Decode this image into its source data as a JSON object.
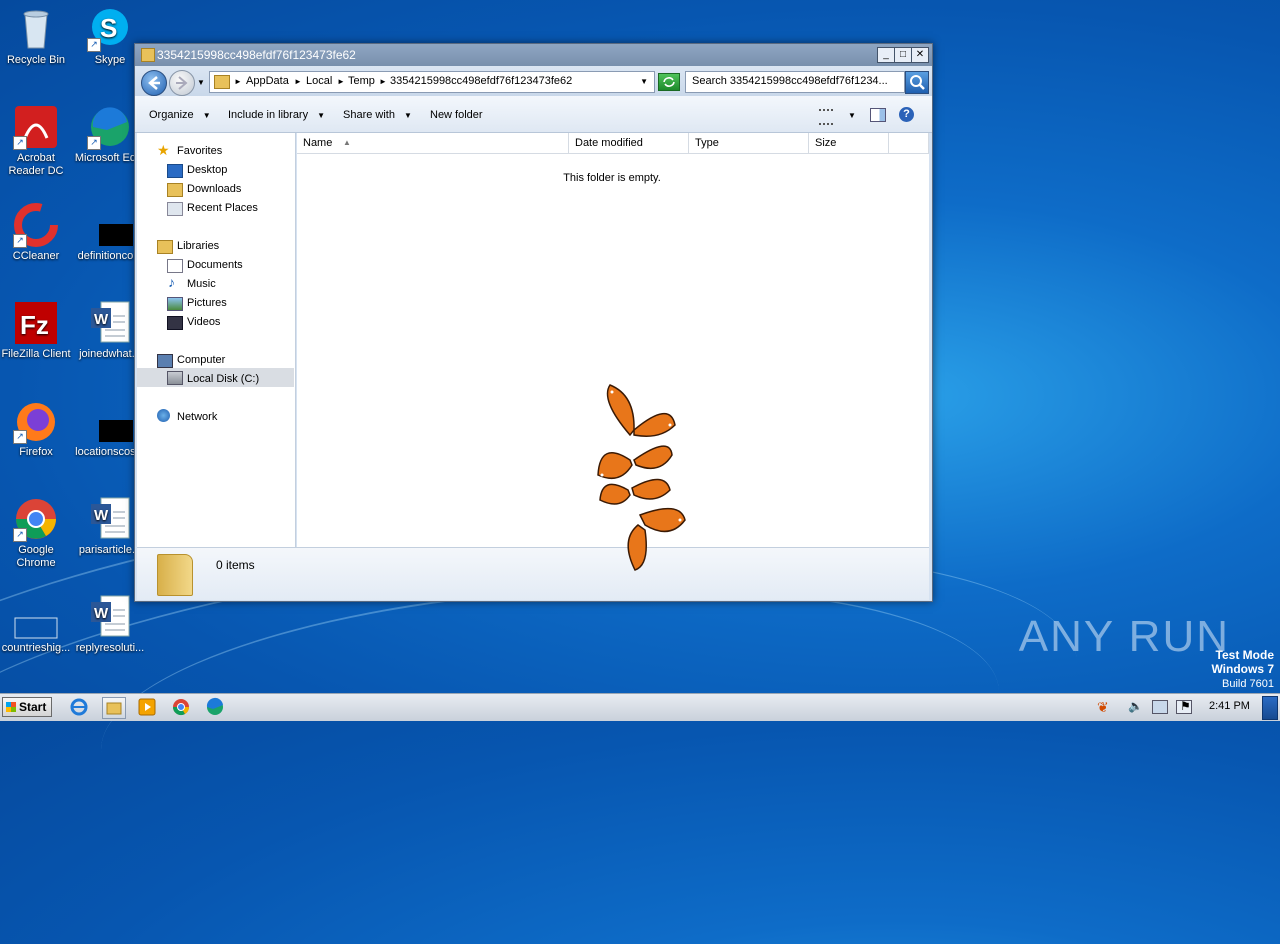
{
  "desktop": {
    "icons": [
      {
        "label": "Recycle Bin"
      },
      {
        "label": "Skype"
      },
      {
        "label": "Acrobat Reader DC"
      },
      {
        "label": "Microsoft Ed..."
      },
      {
        "label": "CCleaner"
      },
      {
        "label": "definitionco..."
      },
      {
        "label": "FileZilla Client"
      },
      {
        "label": "joinedwhat..."
      },
      {
        "label": "Firefox"
      },
      {
        "label": "locationscos..."
      },
      {
        "label": "Google Chrome"
      },
      {
        "label": "parisarticle..."
      },
      {
        "label": "countrieshig..."
      },
      {
        "label": "replyresoluti..."
      }
    ]
  },
  "window": {
    "title": "3354215998cc498efdf76f123473fe62",
    "breadcrumb": [
      "AppData",
      "Local",
      "Temp",
      "3354215998cc498efdf76f123473fe62"
    ],
    "search_placeholder": "Search 3354215998cc498efdf76f1234...",
    "toolbar": {
      "organize": "Organize",
      "include_in_library": "Include in library",
      "share_with": "Share with",
      "new_folder": "New folder"
    },
    "nav": {
      "favorites": "Favorites",
      "desktop": "Desktop",
      "downloads": "Downloads",
      "recent_places": "Recent Places",
      "libraries": "Libraries",
      "documents": "Documents",
      "music": "Music",
      "pictures": "Pictures",
      "videos": "Videos",
      "computer": "Computer",
      "local_disk": "Local Disk (C:)",
      "network": "Network"
    },
    "columns": {
      "name": "Name",
      "date_modified": "Date modified",
      "type": "Type",
      "size": "Size"
    },
    "empty_message": "This folder is empty.",
    "item_count": "0 items"
  },
  "taskbar": {
    "start": "Start",
    "clock": "2:41 PM"
  },
  "watermark": {
    "brand": "ANY RUN",
    "line1": "Test Mode",
    "line2": "Windows 7",
    "line3": "Build 7601"
  }
}
